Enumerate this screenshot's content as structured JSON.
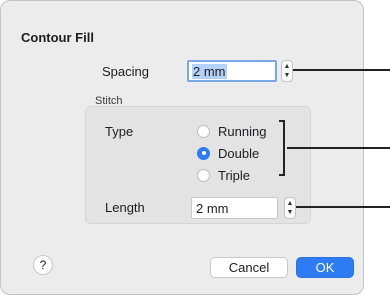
{
  "dialog": {
    "title": "Contour Fill",
    "spacing": {
      "label": "Spacing",
      "value": "2 mm",
      "stepper_icon": "chevron-up-down-icon"
    },
    "stitch_group_label": "Stitch",
    "type": {
      "label": "Type",
      "options": [
        {
          "label": "Running",
          "selected": false
        },
        {
          "label": "Double",
          "selected": true
        },
        {
          "label": "Triple",
          "selected": false
        }
      ]
    },
    "length": {
      "label": "Length",
      "value": "2 mm",
      "stepper_icon": "chevron-up-down-icon"
    },
    "help_label": "?",
    "cancel_label": "Cancel",
    "ok_label": "OK"
  },
  "colors": {
    "accent": "#2d7cf6",
    "selection": "#b3d2fb",
    "panel": "#ececec"
  }
}
